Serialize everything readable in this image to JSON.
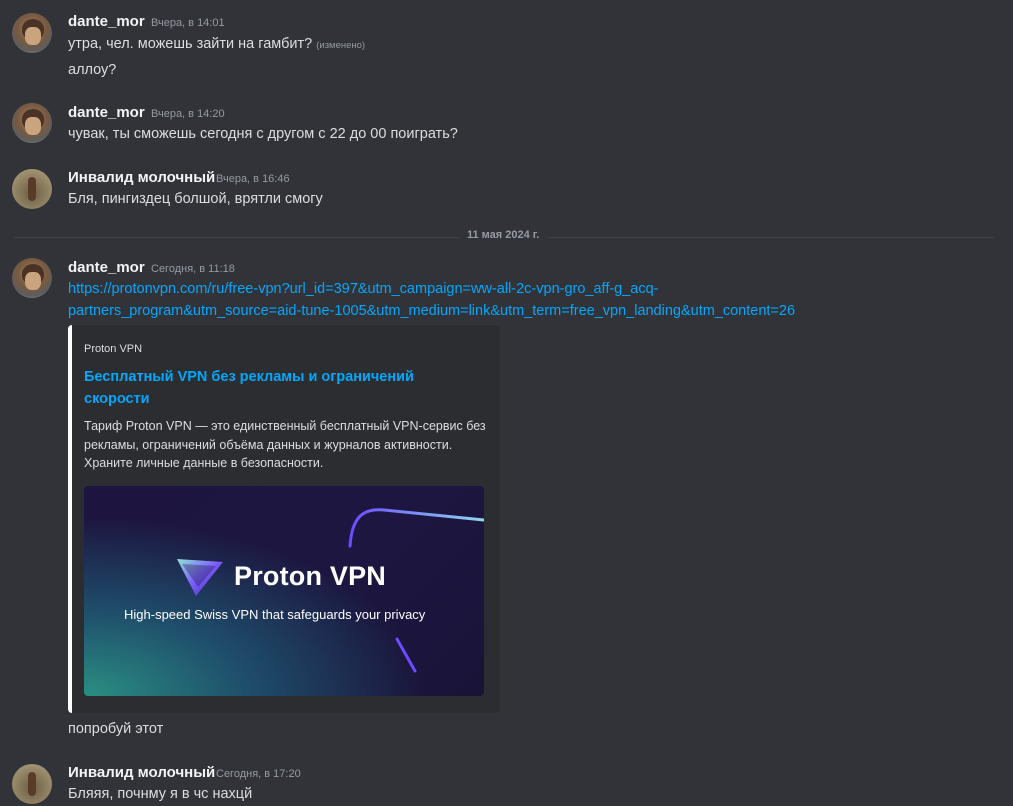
{
  "messages": [
    {
      "author": "dante_mor",
      "time": "Вчера, в 14:01",
      "lines": [
        "утра, чел. можешь зайти на гамбит?",
        "аллоу?"
      ],
      "edited": "(изменено)"
    },
    {
      "author": "dante_mor",
      "time": "Вчера, в 14:20",
      "lines": [
        "чувак, ты сможешь сегодня с другом с 22 до 00 поиграть?"
      ]
    },
    {
      "author": "Инвалид молочный",
      "time": "Вчера, в 16:46",
      "lines": [
        "Бля, пингиздец болшой, врятли смогу"
      ]
    },
    {
      "author": "dante_mor",
      "time": "Сегодня, в 11:18",
      "link_line1": "https://protonvpn.com/ru/free-vpn?url_id=397&utm_campaign=ww-all-2c-vpn-gro_aff-g_acq-",
      "link_line2": "partners_program&utm_source=aid-tune-1005&utm_medium=link&utm_term=free_vpn_landing&utm_content=26",
      "after_embed": "попробуй этот"
    },
    {
      "author": "Инвалид молочный",
      "time": "Сегодня, в 17:20",
      "lines": [
        "Бляяя, почнму я в чс нахцй"
      ]
    }
  ],
  "date_divider": "11 мая 2024 г.",
  "embed": {
    "provider": "Proton VPN",
    "title": "Бесплатный VPN без рекламы и ограничений скорости",
    "description": "Тариф Proton VPN — это единственный бесплатный VPN-сервис без рекламы, ограничений объёма данных и журналов активности. Храните личные данные в безопасности.",
    "image_title": "Proton VPN",
    "image_subtitle": "High-speed Swiss VPN that safeguards your privacy",
    "accent_color": "#ffffff"
  },
  "colors": {
    "background": "#313338",
    "link": "#00a8fc",
    "embed_bg": "#2b2d31"
  }
}
